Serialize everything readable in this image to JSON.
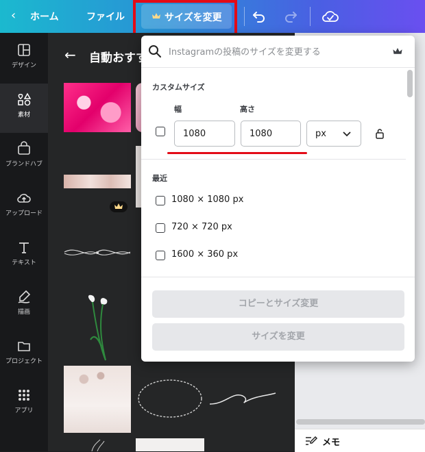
{
  "topbar": {
    "home_label": "ホーム",
    "file_label": "ファイル",
    "resize_label": "サイズを変更"
  },
  "rail": {
    "items": [
      {
        "label": "デザイン"
      },
      {
        "label": "素材"
      },
      {
        "label": "ブランドハブ"
      },
      {
        "label": "アップロード"
      },
      {
        "label": "テキスト"
      },
      {
        "label": "描画"
      },
      {
        "label": "プロジェクト"
      },
      {
        "label": "アプリ"
      }
    ]
  },
  "panel": {
    "title": "自動おすす"
  },
  "popup": {
    "search_placeholder": "Instagramの投稿のサイズを変更する",
    "custom_size_label": "カスタムサイズ",
    "width_label": "幅",
    "height_label": "高さ",
    "width_value": "1080",
    "height_value": "1080",
    "unit_value": "px",
    "recent_label": "最近",
    "recent": [
      {
        "label": "1080 × 1080 px"
      },
      {
        "label": "720 × 720 px"
      },
      {
        "label": "1600 × 360 px"
      }
    ],
    "copy_resize_label": "コピーとサイズ変更",
    "resize_label": "サイズを変更"
  },
  "memo_label": "メモ",
  "colors": {
    "accent_red": "#e30b17",
    "topbar_start": "#1bb9cf",
    "topbar_end": "#6a4ff0"
  }
}
